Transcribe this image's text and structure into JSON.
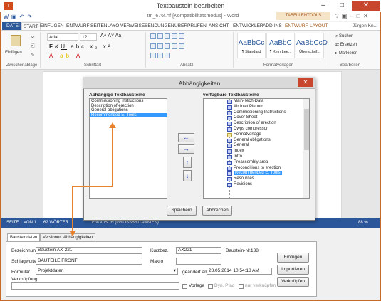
{
  "window": {
    "title": "Textbaustein bearbeiten",
    "icon": "app-icon-T"
  },
  "word": {
    "doc_title": "tm_676f.rtf [Kompatibilitätsmodus] - Word",
    "tools_context": "TABELLENTOOLS",
    "user": "Jürgen Kn..."
  },
  "ribbon_tabs": [
    "DATEI",
    "START",
    "EINFÜGEN",
    "ENTWURF",
    "SEITENLAYO",
    "VERWEISE",
    "SENDUNGEN",
    "ÜBERPRÜFEN",
    "ANSICHT",
    "ENTWICKLER",
    "ADD-INS",
    "ENTWURF",
    "LAYOUT"
  ],
  "ribbon": {
    "paste": "Einfügen",
    "clipboard": "Zwischenablage",
    "font_name": "Arial",
    "font_size": "12",
    "font_group": "Schriftart",
    "para_group": "Absatz",
    "styles": [
      {
        "preview": "AaBbCc",
        "name": "¶ Standard"
      },
      {
        "preview": "AaBbC",
        "name": "¶ Kein Lee..."
      },
      {
        "preview": "AaBbCcD",
        "name": "Überschrif..."
      }
    ],
    "styles_group": "Formatvorlagen",
    "edit_items": [
      "Suchen",
      "Ersetzen",
      "Markieren"
    ],
    "edit_group": "Bearbeiten"
  },
  "status": {
    "page": "SEITE 1 VON 1",
    "words": "62 WÖRTER",
    "lang": "ENGLISCH (GROSSBRITANNIEN)",
    "zoom": "88 %"
  },
  "dialog": {
    "title": "Abhängigkeiten",
    "left_header": "Abhängige Textbausteine",
    "left_items": [
      "Commissioning Instructions",
      "Description of erection",
      "General obligations",
      "Recommended E. Tools"
    ],
    "left_selected": 3,
    "right_header": "verfügbare Textbausteine",
    "right_items": [
      "Main-Tech-Data",
      "Air Inlet Plenum",
      "Commissioning Instructions",
      "Cover Sheet",
      "Description of erection",
      "Dwgs compressor",
      "Formatvorlage",
      "General obligations",
      "General",
      "Index",
      "Intro",
      "Preassembly area",
      "Preconditions to erection",
      "Recommended E. Tools",
      "Resources",
      "Revisions"
    ],
    "right_selected": 13,
    "save": "Speichern",
    "cancel": "Abbrechen",
    "arrow_left": "←",
    "arrow_right": "→",
    "arrow_up": "↑",
    "arrow_down": "↓"
  },
  "lower": {
    "tabs": [
      "Bausteindaten",
      "Versionen",
      "Abhängigkeiten"
    ],
    "designation_label": "Bezeichnung",
    "designation": "Baustein AX-221",
    "short_label": "Kurzbez.",
    "short": "AX221",
    "number_label": "Baustein-Nr.:",
    "number": "138",
    "keyword_label": "Schlagworte",
    "keyword": "BAUTEILE FRONT",
    "macro_label": "Makro",
    "macro": "",
    "form_label": "Formular",
    "form": "Projektdaten",
    "changed_label": "geändert am",
    "changed": "28.05.2014 10:54:18 AM",
    "link_label": "Verknüpfung",
    "template_label": "Vorlage",
    "dyn_label": "Dyn. Pfad",
    "readonly_label": "nur verknüpfen",
    "insert": "Einfügen",
    "import": "Importieren",
    "link": "Verknüpfen"
  }
}
